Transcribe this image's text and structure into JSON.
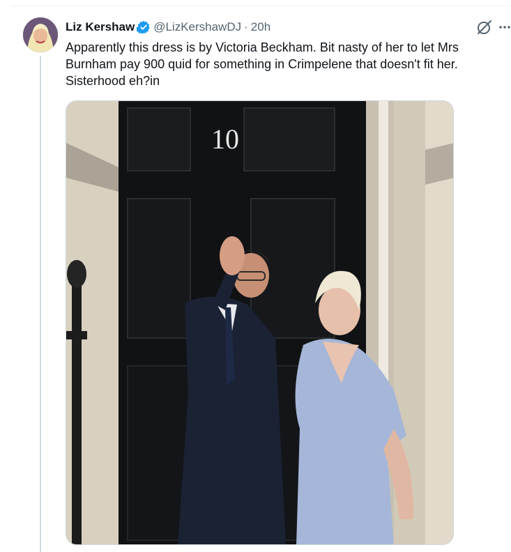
{
  "tweet": {
    "author_name": "Liz Kershaw",
    "handle": "@LizKershawDJ",
    "separator": "·",
    "time": "20h",
    "text": "Apparently this dress is by Victoria Beckham. Bit nasty of her to let Mrs Burnham pay 900 quid for something in Crimpelene that doesn't fit her. Sisterhood eh?in",
    "verified": true,
    "verified_color": "#1d9bf0",
    "media": {
      "door_number": "10"
    }
  },
  "icons": {
    "avatar": "avatar",
    "verified": "verified-badge-icon",
    "grok": "grok-icon",
    "more": "more-options-icon"
  }
}
